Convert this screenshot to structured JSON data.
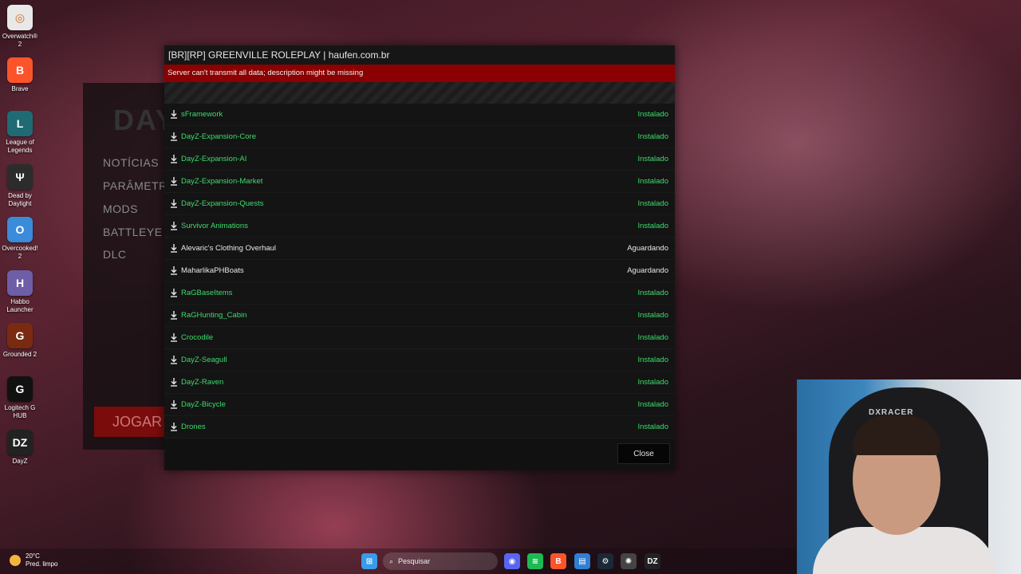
{
  "desktop": {
    "icons": [
      {
        "label": "Overwatch® 2",
        "glyph": "◎",
        "color": "#e8e8e8",
        "icon": "overwatch-icon"
      },
      {
        "label": "Brave",
        "glyph": "B",
        "color": "#fb542b",
        "icon": "brave-icon"
      },
      {
        "label": "League of Legends",
        "glyph": "L",
        "color": "#1e6b73",
        "icon": "league-of-legends-icon"
      },
      {
        "label": "Dead by Daylight",
        "glyph": "Ψ",
        "color": "#2c2c2c",
        "icon": "dead-by-daylight-icon"
      },
      {
        "label": "Overcooked! 2",
        "glyph": "O",
        "color": "#3a8bd9",
        "icon": "overcooked-icon"
      },
      {
        "label": "Habbo Launcher",
        "glyph": "H",
        "color": "#6e5ea8",
        "icon": "habbo-icon"
      },
      {
        "label": "Grounded 2",
        "glyph": "G",
        "color": "#7a2a10",
        "icon": "grounded-icon"
      },
      {
        "label": "Logitech G HUB",
        "glyph": "G",
        "color": "#111111",
        "icon": "logitech-icon"
      },
      {
        "label": "DayZ",
        "glyph": "DZ",
        "color": "#222222",
        "icon": "dayz-icon"
      }
    ]
  },
  "launcher": {
    "logo": "DAY",
    "menu": [
      "NOTÍCIAS",
      "PARÂMETR",
      "MODS",
      "BATTLEYE",
      "DLC"
    ],
    "play_label": "JOGAR"
  },
  "dialog": {
    "title": "[BR][RP] GREENVILLE ROLEPLAY | haufen.com.br",
    "error": "Server can't transmit all data; description might be missing",
    "close_label": "Close",
    "mods": [
      {
        "name": "sFramework",
        "status": "Instalado",
        "installed": true
      },
      {
        "name": "DayZ-Expansion-Core",
        "status": "Instalado",
        "installed": true
      },
      {
        "name": "DayZ-Expansion-AI",
        "status": "Instalado",
        "installed": true
      },
      {
        "name": "DayZ-Expansion-Market",
        "status": "Instalado",
        "installed": true
      },
      {
        "name": "DayZ-Expansion-Quests",
        "status": "Instalado",
        "installed": true
      },
      {
        "name": "Survivor Animations",
        "status": "Instalado",
        "installed": true
      },
      {
        "name": "Alevaric's Clothing Overhaul",
        "status": "Aguardando",
        "installed": false
      },
      {
        "name": "MaharlikaPHBoats",
        "status": "Aguardando",
        "installed": false
      },
      {
        "name": "RaGBaseItems",
        "status": "Instalado",
        "installed": true
      },
      {
        "name": "RaGHunting_Cabin",
        "status": "Instalado",
        "installed": true
      },
      {
        "name": "Crocodile",
        "status": "Instalado",
        "installed": true
      },
      {
        "name": "DayZ-Seagull",
        "status": "Instalado",
        "installed": true
      },
      {
        "name": "DayZ-Raven",
        "status": "Instalado",
        "installed": true
      },
      {
        "name": "DayZ-Bicycle",
        "status": "Instalado",
        "installed": true
      },
      {
        "name": "Drones",
        "status": "Instalado",
        "installed": true
      }
    ]
  },
  "webcam": {
    "chair_brand": "DXRACER"
  },
  "taskbar": {
    "weather_temp": "20°C",
    "weather_desc": "Pred. limpo",
    "search_placeholder": "Pesquisar",
    "apps": [
      {
        "icon": "windows-start-icon",
        "glyph": "⊞",
        "color": "#3a9be8"
      },
      {
        "icon": "discord-icon",
        "glyph": "◉",
        "color": "#5865f2"
      },
      {
        "icon": "spotify-icon",
        "glyph": "≋",
        "color": "#1db954"
      },
      {
        "icon": "brave-taskbar-icon",
        "glyph": "B",
        "color": "#fb542b"
      },
      {
        "icon": "notepad-icon",
        "glyph": "▤",
        "color": "#2f7fd6"
      },
      {
        "icon": "steam-icon",
        "glyph": "⚙",
        "color": "#1b2838"
      },
      {
        "icon": "chatgpt-icon",
        "glyph": "✺",
        "color": "#444444"
      },
      {
        "icon": "dayz-taskbar-icon",
        "glyph": "DZ",
        "color": "#222222"
      }
    ]
  }
}
